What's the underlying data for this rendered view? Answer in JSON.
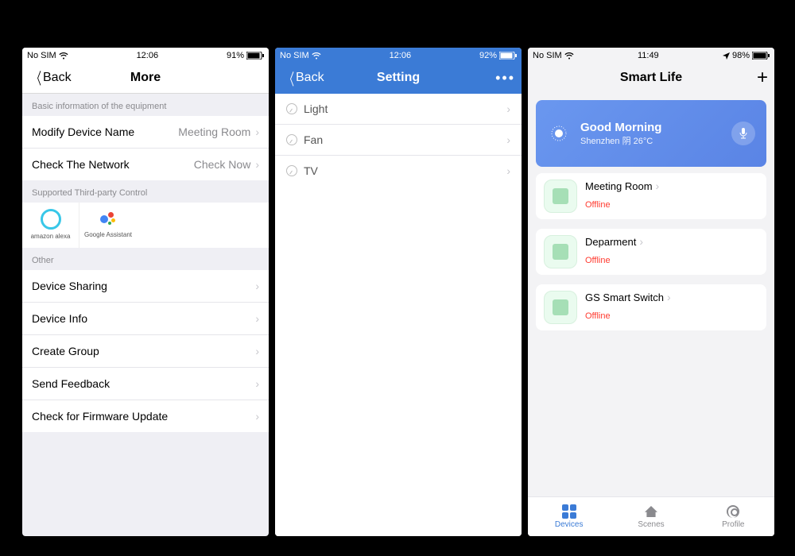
{
  "phone1": {
    "status": {
      "carrier": "No SIM",
      "time": "12:06",
      "battery": "91%"
    },
    "nav": {
      "back": "Back",
      "title": "More"
    },
    "section_basic": "Basic information of the equipment",
    "rows_basic": [
      {
        "label": "Modify Device Name",
        "value": "Meeting Room"
      },
      {
        "label": "Check The Network",
        "value": "Check Now"
      }
    ],
    "section_tp": "Supported Third-party Control",
    "tp": [
      {
        "key": "alexa",
        "label": "amazon alexa"
      },
      {
        "key": "gassist",
        "label": "Google Assistant"
      }
    ],
    "section_other": "Other",
    "rows_other": [
      {
        "label": "Device Sharing"
      },
      {
        "label": "Device Info"
      },
      {
        "label": "Create Group"
      },
      {
        "label": "Send Feedback"
      },
      {
        "label": "Check for Firmware Update"
      }
    ]
  },
  "phone2": {
    "status": {
      "carrier": "No SIM",
      "time": "12:06",
      "battery": "92%"
    },
    "nav": {
      "back": "Back",
      "title": "Setting"
    },
    "rows": [
      {
        "label": "Light"
      },
      {
        "label": "Fan"
      },
      {
        "label": "TV"
      }
    ]
  },
  "phone3": {
    "status": {
      "carrier": "No SIM",
      "time": "11:49",
      "battery": "98%"
    },
    "nav": {
      "title": "Smart Life"
    },
    "hero": {
      "greeting": "Good Morning",
      "location": "Shenzhen 阴  26°C"
    },
    "devices": [
      {
        "name": "Meeting Room",
        "status": "Offline"
      },
      {
        "name": "Deparment",
        "status": "Offline"
      },
      {
        "name": "GS Smart Switch",
        "status": "Offline"
      }
    ],
    "tabs": [
      {
        "key": "devices",
        "label": "Devices",
        "active": true
      },
      {
        "key": "scenes",
        "label": "Scenes"
      },
      {
        "key": "profile",
        "label": "Profile"
      }
    ]
  }
}
